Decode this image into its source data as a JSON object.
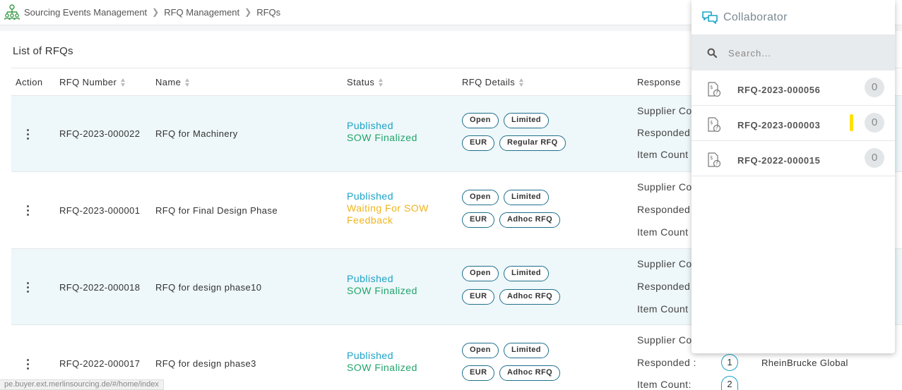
{
  "breadcrumb": [
    "Sourcing Events Management",
    "RFQ Management",
    "RFQs"
  ],
  "list_title": "List of RFQs",
  "columns": {
    "action": "Action",
    "rfq_number": "RFQ Number",
    "name": "Name",
    "status": "Status",
    "rfq_details": "RFQ Details",
    "response": "Response"
  },
  "rows": [
    {
      "number": "RFQ-2023-000022",
      "name": "RFQ for Machinery",
      "status1": "Published",
      "status2": "SOW Finalized",
      "tags": [
        "Open",
        "Limited",
        "EUR",
        "Regular RFQ"
      ],
      "resp": [
        "Supplier Co",
        "Responded",
        "Item Count"
      ]
    },
    {
      "number": "RFQ-2023-000001",
      "name": "RFQ for Final Design Phase",
      "status1": "Published",
      "status2a": "Waiting For SOW",
      "status2b": "Feedback",
      "tags": [
        "Open",
        "Limited",
        "EUR",
        "Adhoc RFQ"
      ],
      "resp": [
        "Supplier Co",
        "Responded",
        "Item Count"
      ]
    },
    {
      "number": "RFQ-2022-000018",
      "name": "RFQ for design phase10",
      "status1": "Published",
      "status2": "SOW Finalized",
      "tags": [
        "Open",
        "Limited",
        "EUR",
        "Adhoc RFQ"
      ],
      "resp": [
        "Supplier Co",
        "Responded",
        "Item Count"
      ]
    },
    {
      "number": "RFQ-2022-000017",
      "name": "RFQ for design phase3",
      "status1": "Published",
      "status2": "SOW Finalized",
      "tags": [
        "Open",
        "Limited",
        "EUR",
        "Adhoc RFQ"
      ],
      "resp": [
        "Supplier Co",
        "Responded :",
        "Item Count:"
      ],
      "responded_count": "1",
      "item_count": "2",
      "supplier_name": "RheinBrucke Global"
    }
  ],
  "status_url": "pe.buyer.ext.merlinsourcing.de/#/home/index",
  "collaborator": {
    "title": "Collaborator",
    "search_placeholder": "Search...",
    "items": [
      {
        "label": "RFQ-2023-000056",
        "count": "0"
      },
      {
        "label": "RFQ-2023-000003",
        "count": "0"
      },
      {
        "label": "RFQ-2022-000015",
        "count": "0"
      }
    ]
  },
  "colors": {
    "accent": "#1aa3c8",
    "sow": "#1fa56a",
    "waiting": "#f0b41c",
    "tag_border": "#1e6e8c",
    "highlight": "#ffe000"
  }
}
